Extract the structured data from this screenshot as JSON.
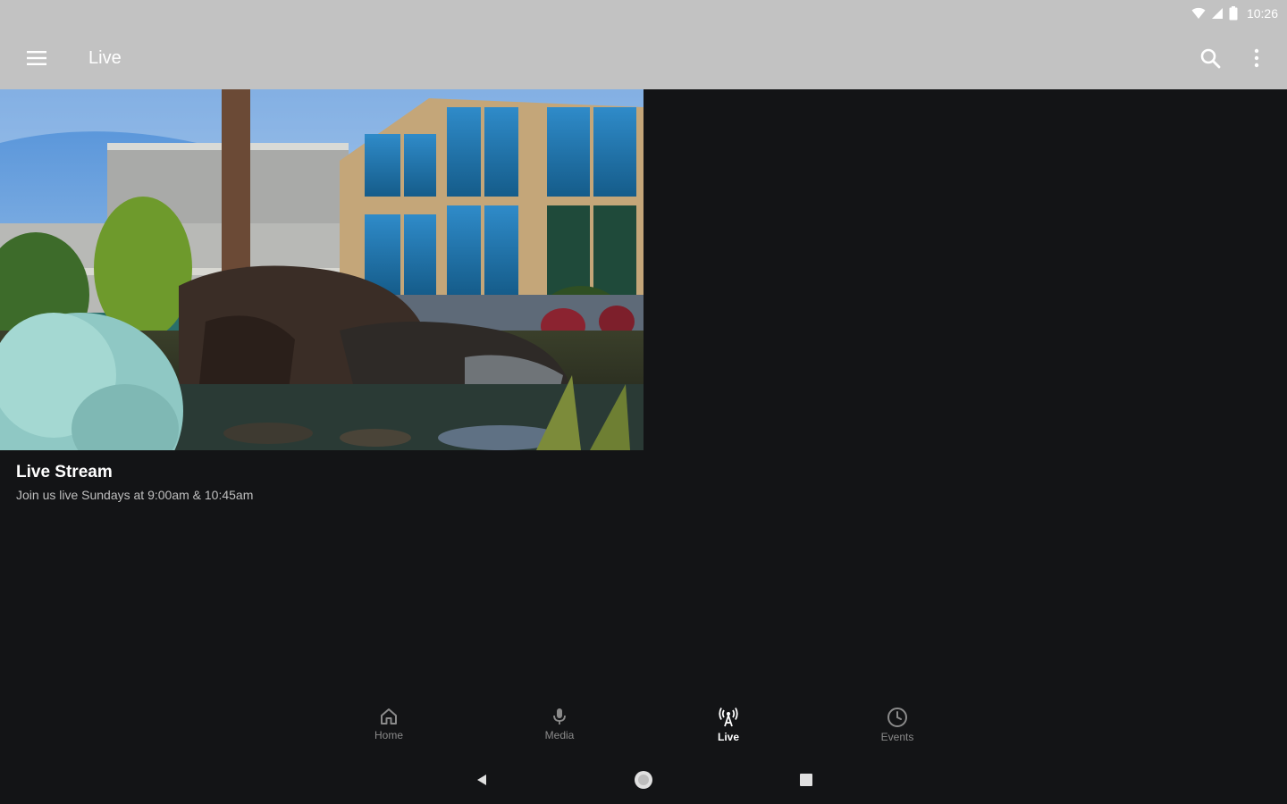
{
  "status_bar": {
    "time": "10:26",
    "icons": [
      "wifi-icon",
      "cell-signal-icon",
      "battery-icon"
    ]
  },
  "app_bar": {
    "title": "Live",
    "icons": [
      "hamburger-menu-icon",
      "search-icon",
      "more-vertical-icon"
    ]
  },
  "card": {
    "title": "Live Stream",
    "subtitle": "Join us live Sundays at 9:00am & 10:45am"
  },
  "bottom_nav": {
    "items": [
      {
        "label": "Home",
        "icon": "home-icon",
        "active": false
      },
      {
        "label": "Media",
        "icon": "microphone-icon",
        "active": false
      },
      {
        "label": "Live",
        "icon": "broadcast-tower-icon",
        "active": true
      },
      {
        "label": "Events",
        "icon": "clock-icon",
        "active": false
      }
    ]
  },
  "system_nav": {
    "icons": [
      "back-triangle-icon",
      "home-circle-icon",
      "recents-square-icon"
    ]
  },
  "colors": {
    "background": "#131416",
    "app_bar": "#c2c2c2",
    "active_nav": "#ffffff",
    "inactive_nav": "#8a8a8a"
  }
}
